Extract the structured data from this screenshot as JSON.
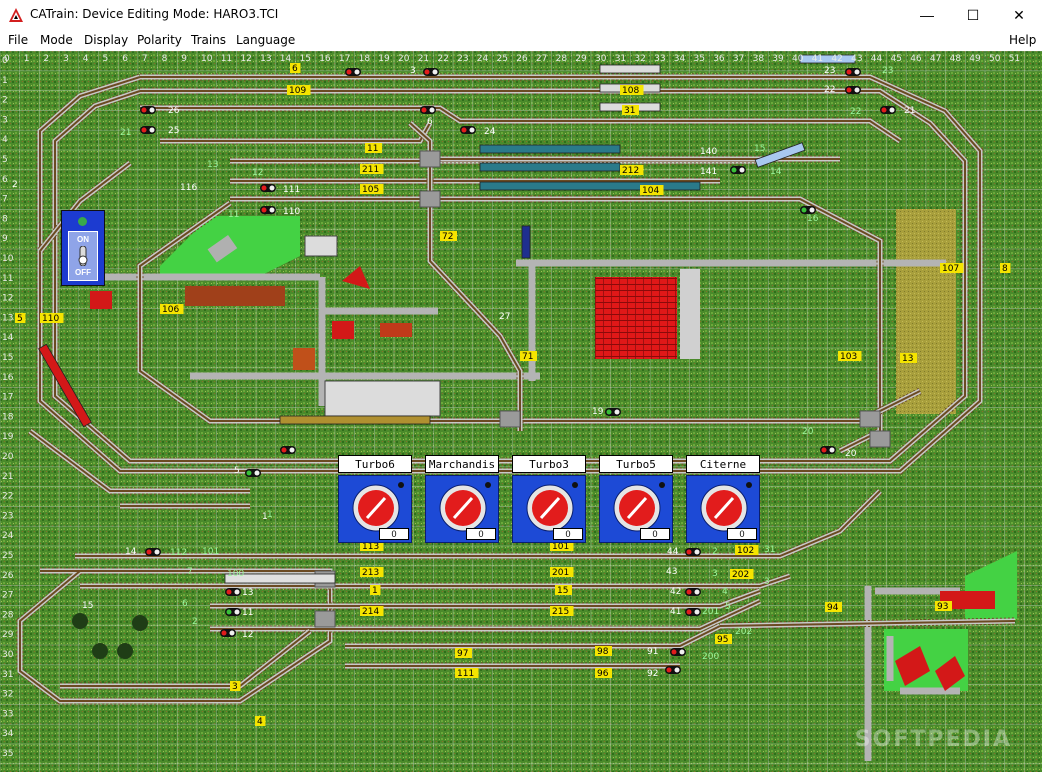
{
  "window": {
    "title": "CATrain: Device Editing Mode: HARO3.TCI",
    "controls": {
      "minimize": "—",
      "maximize": "☐",
      "close": "✕"
    }
  },
  "menu": [
    "File",
    "Mode",
    "Display",
    "Polarity",
    "Trains",
    "Language"
  ],
  "help_menu": "Help",
  "layout": {
    "column_numbers": [
      "0",
      "1",
      "2",
      "3",
      "4",
      "5",
      "6",
      "7",
      "8",
      "9",
      "10",
      "11",
      "12",
      "13",
      "14",
      "15",
      "16",
      "17",
      "18",
      "19",
      "20",
      "21",
      "22",
      "23",
      "24",
      "25",
      "26",
      "27",
      "28",
      "29",
      "30",
      "31",
      "32",
      "33",
      "34",
      "35",
      "36",
      "37",
      "38",
      "39",
      "40",
      "41",
      "42",
      "43",
      "44",
      "45",
      "46",
      "47",
      "48",
      "49",
      "50",
      "51"
    ],
    "row_numbers": [
      "0",
      "1",
      "2",
      "3",
      "4",
      "5",
      "6",
      "7",
      "8",
      "9",
      "10",
      "11",
      "12",
      "13",
      "14",
      "15",
      "16",
      "17",
      "18",
      "19",
      "20",
      "21",
      "22",
      "23",
      "24",
      "25",
      "26",
      "27",
      "28",
      "29",
      "30",
      "31",
      "32",
      "33",
      "34",
      "35"
    ],
    "yellow_labels": [
      "6",
      "109",
      "108",
      "31",
      "11",
      "211",
      "105",
      "72",
      "212",
      "104",
      "107",
      "8",
      "106",
      "110",
      "5",
      "71",
      "103",
      "13",
      "113",
      "101",
      "102",
      "213",
      "201",
      "1",
      "15",
      "214",
      "215",
      "202",
      "94",
      "93",
      "95",
      "98",
      "97",
      "96",
      "111",
      "4",
      "3"
    ],
    "green_labels": [
      "21",
      "13",
      "12",
      "11",
      "22",
      "23",
      "15",
      "14",
      "16",
      "20",
      "101",
      "7",
      "6",
      "2",
      "2",
      "3",
      "4",
      "5",
      "1",
      "200",
      "201",
      "202",
      "112",
      "100",
      "31",
      "3"
    ],
    "blue_labels": [
      "2",
      "3",
      "26",
      "25",
      "6",
      "24",
      "116",
      "111",
      "110",
      "27",
      "140",
      "141",
      "23",
      "22",
      "21",
      "19",
      "20",
      "5",
      "1",
      "14",
      "15",
      "13",
      "11",
      "12",
      "44",
      "43",
      "42",
      "41",
      "91",
      "92"
    ],
    "controllers": [
      {
        "name": "Turbo6",
        "number": "0"
      },
      {
        "name": "Marchandis",
        "number": "0"
      },
      {
        "name": "Turbo3",
        "number": "0"
      },
      {
        "name": "Turbo5",
        "number": "0"
      },
      {
        "name": "Citerne",
        "number": "0"
      }
    ],
    "onoff": {
      "on": "ON",
      "off": "OFF"
    }
  },
  "watermark": "SOFTPEDIA",
  "colors": {
    "grass": "#4b8a2b",
    "grid": "#cfd8d3",
    "rail": "#c8c8c8",
    "road": "#b4b4b4",
    "yellow_label": "#f5e400",
    "blue_label": "#1f1f8f",
    "green_label": "#9cf59c",
    "panel_blue": "#1d4ad6",
    "dial_red": "#e21c1c"
  }
}
